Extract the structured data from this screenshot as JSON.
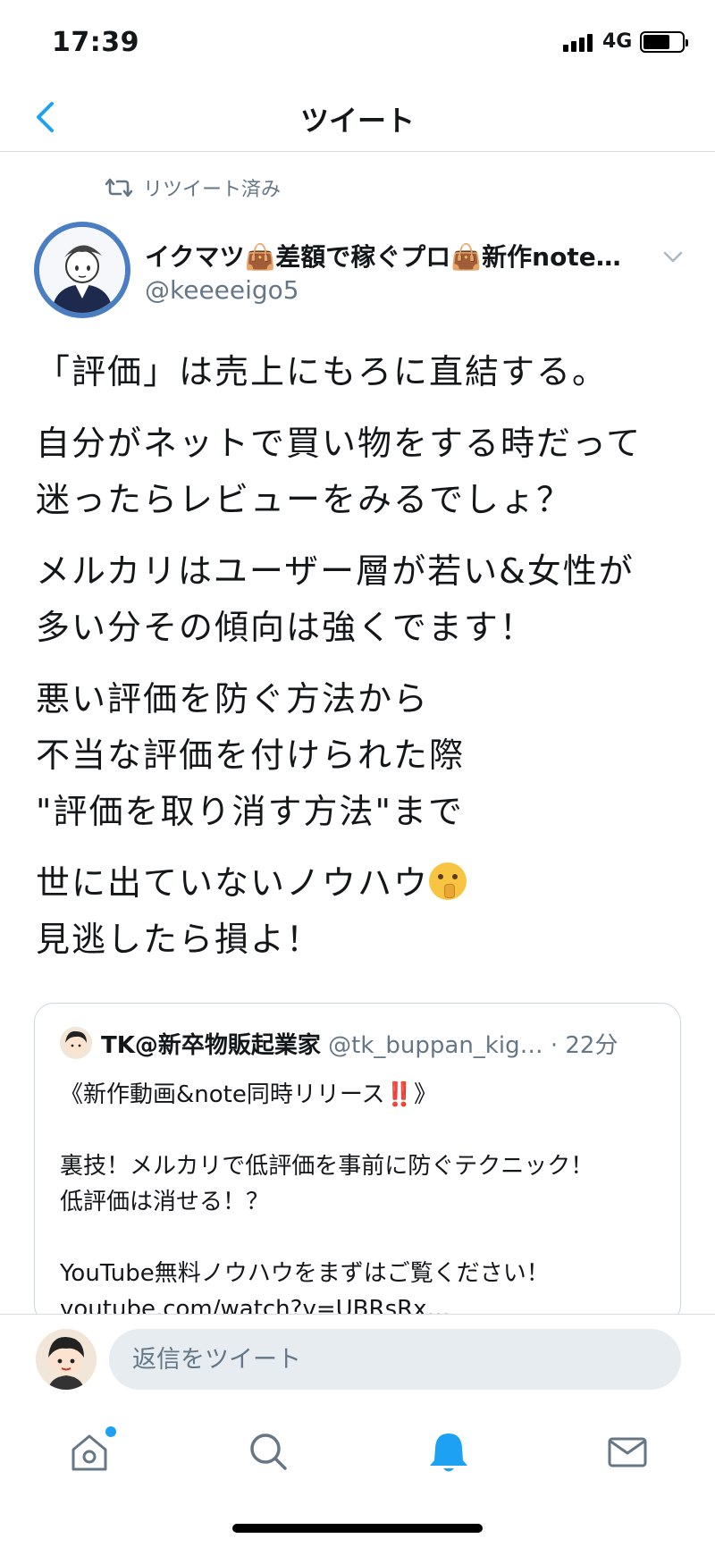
{
  "status_bar": {
    "time": "17:39",
    "network": "4G"
  },
  "nav": {
    "title": "ツイート"
  },
  "retweet": {
    "label": "リツイート済み"
  },
  "author": {
    "display_name": "イクマツ👜差額で稼ぐプロ👜新作note…",
    "handle": "@keeeeigo5"
  },
  "tweet": {
    "paragraphs": [
      [
        "「評価」は売上にもろに直結する。"
      ],
      [
        "自分がネットで買い物をする時だって",
        "迷ったらレビューをみるでしょ？"
      ],
      [
        "メルカリはユーザー層が若い&女性が",
        "多い分その傾向は強くでます！"
      ],
      [
        "悪い評価を防ぐ方法から",
        "不当な評価を付けられた際",
        "\"評価を取り消す方法\"まで"
      ],
      [
        "世に出ていないノウハウ",
        "見逃したら損よ！"
      ]
    ],
    "emoji": "shushing-face"
  },
  "quoted": {
    "name": "TK@新卒物販起業家",
    "handle": "@tk_buppan_kig…",
    "time": "· 22分",
    "lines": {
      "l1": "《新作動画&note同時リリース",
      "l1_mark": "‼️",
      "l1_end": "》",
      "l2": "裏技！メルカリで低評価を事前に防ぐテクニック！",
      "l3": "低評価は消せる！？",
      "l4": "YouTube無料ノウハウをまずはご覧ください！",
      "l5": "youtube.com/watch?v=UBRsRx…"
    }
  },
  "reply": {
    "placeholder": "返信をツイート"
  },
  "tabs": [
    "home",
    "search",
    "notifications",
    "messages"
  ],
  "colors": {
    "accent": "#1da1f2",
    "secondary_text": "#657786",
    "avatar_ring": "#4b7dc3"
  }
}
